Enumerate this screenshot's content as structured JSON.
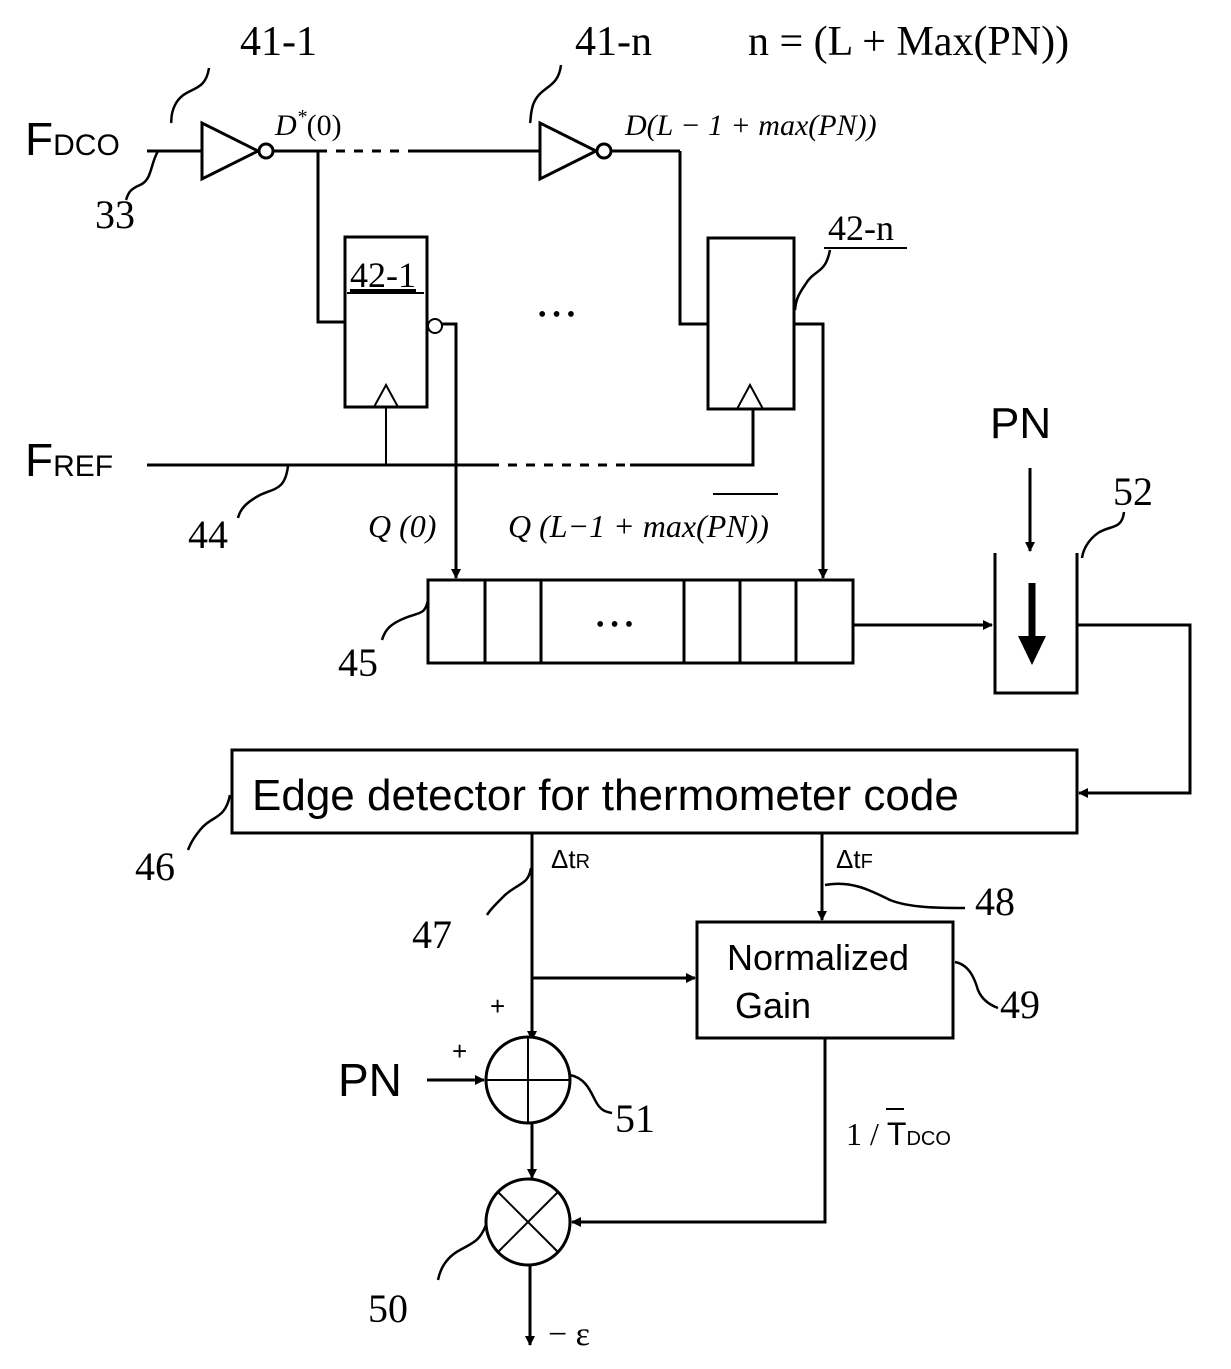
{
  "diagram": {
    "refs": {
      "inv_first": "41-1",
      "inv_last": "41-n",
      "input_33": "33",
      "ff_first": "42-1",
      "ff_last": "42-n",
      "fref_line": "44",
      "register": "45",
      "edge_detector": "46",
      "dtr_line": "47",
      "dtf_line": "48",
      "norm_gain": "49",
      "multiplier": "50",
      "adder": "51",
      "pn_block": "52"
    },
    "equation": "n = (L + Max(PN))",
    "signals": {
      "fdco_main": "F",
      "fdco_sub": "DCO",
      "fref_main": "F",
      "fref_sub": "REF",
      "d0": "D",
      "d0_sup": "*",
      "d0_arg": "(0)",
      "dn": "D(L − 1 + max(PN))",
      "q0": "Q (0)",
      "qn_pre": "Q (L−1 + max(",
      "qn_pn": "PN",
      "qn_post": "))",
      "pn_top": "PN",
      "pn_left": "PN",
      "dtr_main": "Δt",
      "dtr_sub": "R",
      "dtf_main": "Δt",
      "dtf_sub": "F",
      "tdco_pre": "1 / ",
      "tdco_main": "T",
      "tdco_sub": "DCO",
      "plus_top": "+",
      "plus_left": "+",
      "output": "− ε",
      "ellipsis": "•••"
    },
    "blocks": {
      "edge_detector_label": "Edge detector for thermometer code",
      "norm_gain_line1": "Normalized",
      "norm_gain_line2": "Gain"
    }
  }
}
